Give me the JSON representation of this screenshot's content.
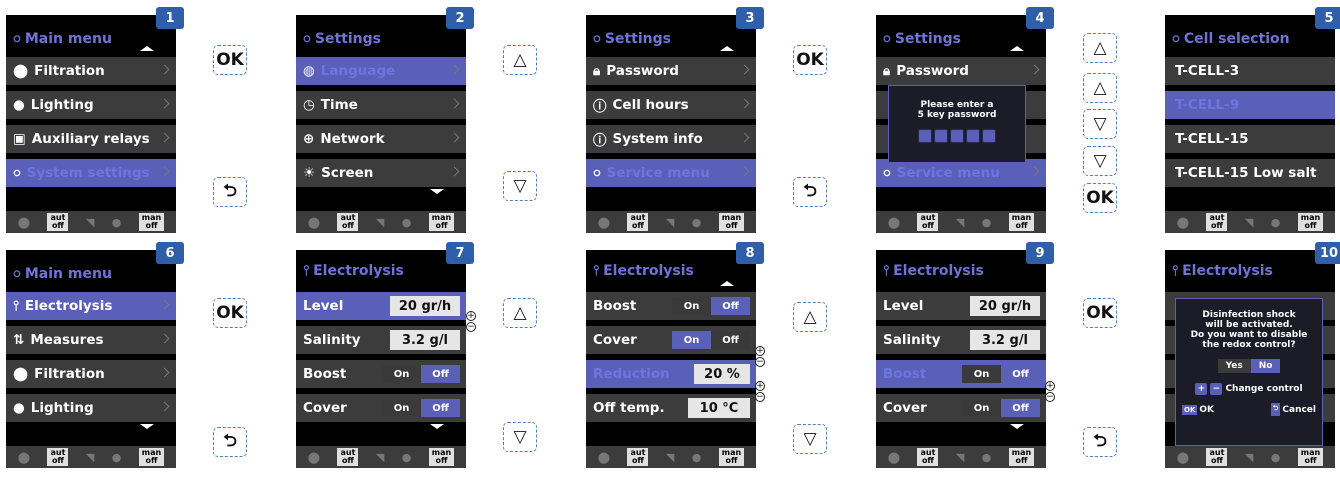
{
  "steps": [
    "1",
    "2",
    "3",
    "4",
    "5",
    "6",
    "7",
    "8",
    "9",
    "10"
  ],
  "titles": {
    "main_menu": "Main menu",
    "settings": "Settings",
    "cell_selection": "Cell selection",
    "electrolysis": "Electrolysis"
  },
  "main_menu_items": [
    "Filtration",
    "Lighting",
    "Auxiliary relays",
    "System settings"
  ],
  "settings_a": [
    "Language",
    "Time",
    "Network",
    "Screen"
  ],
  "settings_b": [
    "Password",
    "Cell hours",
    "System info",
    "Service menu"
  ],
  "password_dialog": {
    "line1": "Please enter a",
    "line2": "5 key password"
  },
  "cells": [
    "T-CELL-3",
    "T-CELL-9",
    "T-CELL-15",
    "T-CELL-15 Low salt"
  ],
  "main_menu_b": [
    "Electrolysis",
    "Measures",
    "Filtration",
    "Lighting"
  ],
  "electrolysis": {
    "level": "Level",
    "level_value": "20 gr/h",
    "salinity": "Salinity",
    "salinity_value": "3.2 g/l",
    "boost": "Boost",
    "cover": "Cover",
    "reduction": "Reduction",
    "reduction_value": "20 %",
    "off_temp": "Off temp.",
    "off_temp_value": "10 °C",
    "on": "On",
    "off": "Off"
  },
  "footer": {
    "aut": "aut",
    "man": "man",
    "off": "off"
  },
  "keys": {
    "ok": "OK",
    "up": "△",
    "down": "▽",
    "back": "⮌"
  },
  "shock_dialog": {
    "l1": "Disinfection shock",
    "l2": "will be activated.",
    "l3": "Do you want to disable",
    "l4": "the redox control?",
    "yes": "Yes",
    "no": "No",
    "change": "Change control",
    "ok": "OK",
    "cancel": "Cancel"
  },
  "plus": "+",
  "minus": "−",
  "colors": {
    "accent": "#5a5fb8",
    "title": "#6f72d8",
    "badge": "#2f5fa8",
    "row": "#3c3c3c",
    "key_border": "#4d7ec6"
  }
}
